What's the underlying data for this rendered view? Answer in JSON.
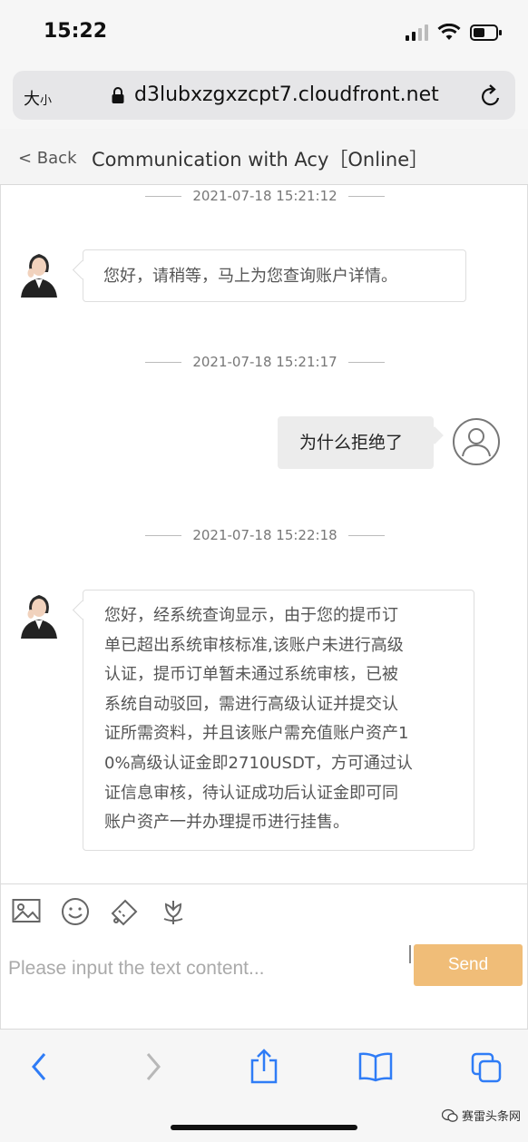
{
  "status": {
    "time": "15:22"
  },
  "browser": {
    "text_size_label": "大",
    "text_size_small": "小",
    "url": "d3lubxzgxzcpt7.cloudfront.net"
  },
  "header": {
    "back_label": "< Back",
    "title": "Communication with Acy［Online］"
  },
  "messages": [
    {
      "timestamp": "2021-07-18 15:21:12",
      "from": "agent",
      "text": "您好，请稍等，马上为您查询账户详情。"
    },
    {
      "timestamp": "2021-07-18 15:21:17",
      "from": "user",
      "text": "为什么拒绝了"
    },
    {
      "timestamp": "2021-07-18 15:22:18",
      "from": "agent",
      "lines": [
        "您好，经系统查询显示，由于您的提币订",
        "单已超出系统审核标准,该账户未进行高级",
        "认证，提币订单暂未通过系统审核，已被",
        "系统自动驳回，需进行高级认证并提交认",
        "证所需资料，并且该账户需充值账户资产1",
        "0%高级认证金即2710USDT，方可通过认",
        "证信息审核，待认证成功后认证金即可同",
        "账户资产一并办理提币进行挂售。"
      ]
    }
  ],
  "composer": {
    "placeholder": "Please input the text content...",
    "send_label": "Send"
  },
  "watermark": "赛雷头条网",
  "colors": {
    "send": "#f0bd78",
    "ios_blue": "#2f7cf6"
  }
}
